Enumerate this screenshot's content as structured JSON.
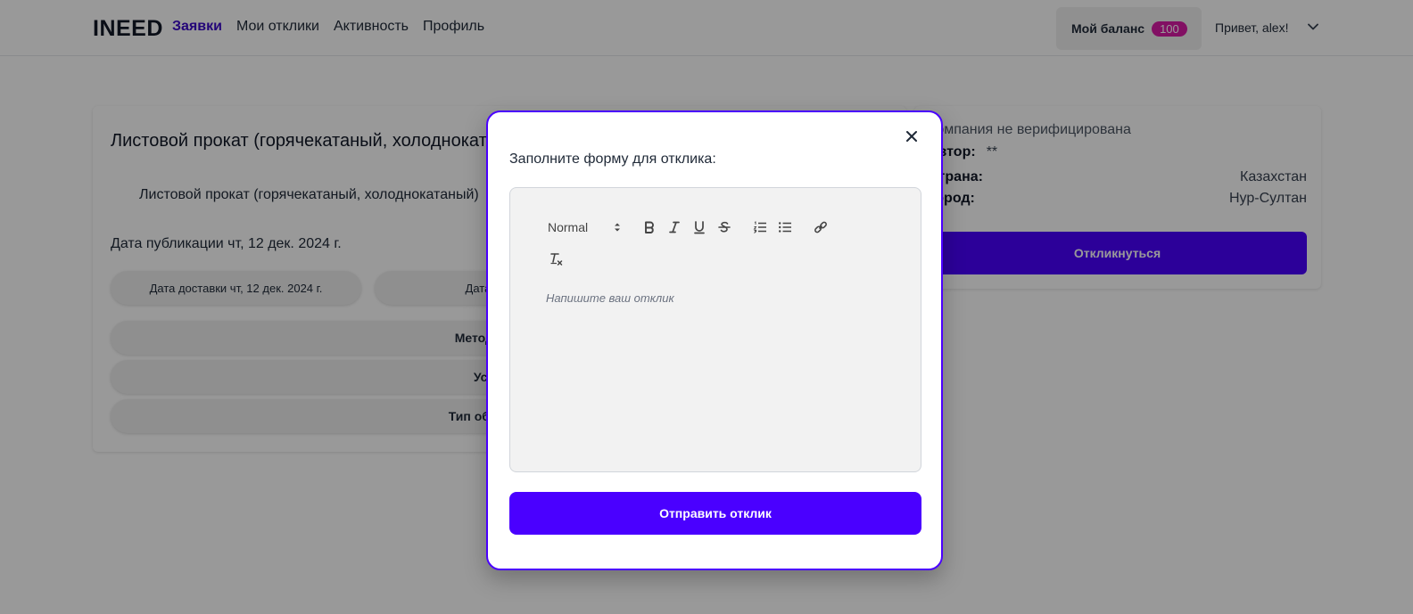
{
  "header": {
    "logo": "INEED",
    "nav": [
      {
        "label": "Заявки",
        "active": true
      },
      {
        "label": "Мои отклики",
        "active": false
      },
      {
        "label": "Активность",
        "active": false
      },
      {
        "label": "Профиль",
        "active": false
      }
    ],
    "balance_label": "Мой баланс",
    "balance_value": "100",
    "greeting": "Привет, alex!",
    "menu_icon": "chevron-down-icon"
  },
  "listing": {
    "title": "Листовой прокат (горячекатаный, холоднокатаный)",
    "subtitle": "Листовой прокат (горячекатаный, холоднокатаный)",
    "publication_date": "Дата публикации чт, 12 дек. 2024 г.",
    "delivery_date": "Дата доставки чт, 12 дек. 2024 г.",
    "purchase_date": "Дата закупки",
    "accordions": [
      "Метод закупки",
      "Условия",
      "Тип объявления"
    ]
  },
  "company": {
    "verification": "Компания не верифицирована",
    "author_label": "Автор:",
    "author_value": "**",
    "country_label": "Страна:",
    "country_value": "Казахстан",
    "city_label": "Город:",
    "city_value": "Нур-Султан",
    "respond_button": "Откликнуться"
  },
  "modal": {
    "heading": "Заполните форму для отклика:",
    "format_select": "Normal",
    "placeholder": "Напишите ваш отклик",
    "submit_button": "Отправить отклик",
    "toolbar_icons": [
      "bold-icon",
      "italic-icon",
      "underline-icon",
      "strike-icon",
      "ordered-list-icon",
      "bullet-list-icon",
      "link-icon",
      "clear-format-icon"
    ]
  },
  "colors": {
    "accent": "#4a00ff",
    "nav_active": "#3b08c9",
    "badge": "#d91aa6"
  }
}
